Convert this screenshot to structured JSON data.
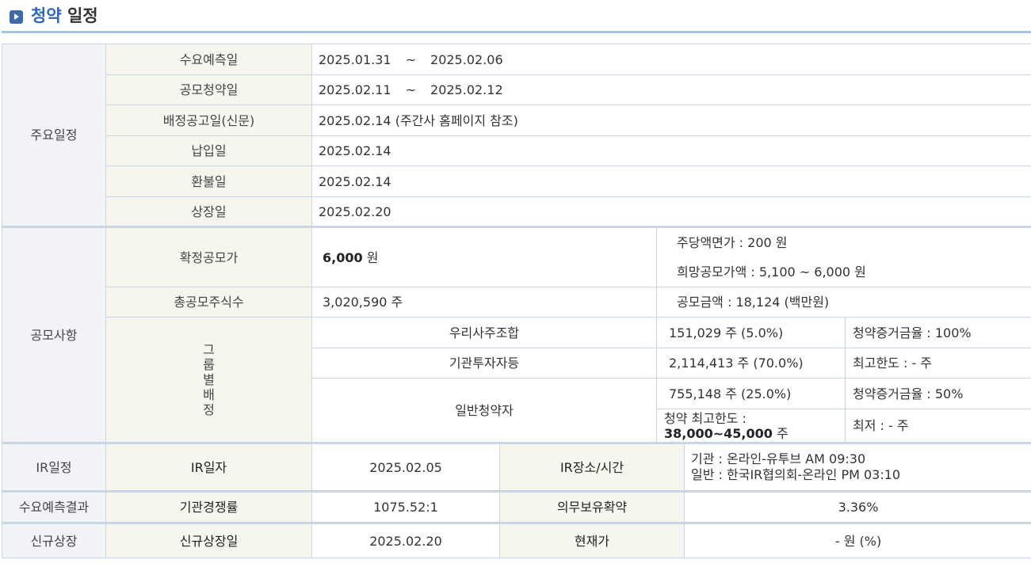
{
  "title": {
    "accent": "청약",
    "rest": " 일정"
  },
  "sections": {
    "key_schedule": {
      "label": "주요일정",
      "rows": [
        {
          "label": "수요예측일",
          "start": "2025.01.31",
          "sep": "~",
          "end": "2025.02.06"
        },
        {
          "label": "공모청약일",
          "start": "2025.02.11",
          "sep": "~",
          "end": "2025.02.12"
        },
        {
          "label": "배정공고일(신문)",
          "value": "2025.02.14 (주간사 홈페이지 참조)"
        },
        {
          "label": "납입일",
          "value": "2025.02.14"
        },
        {
          "label": "환불일",
          "value": "2025.02.14"
        },
        {
          "label": "상장일",
          "value": "2025.02.20"
        }
      ]
    },
    "offering": {
      "label": "공모사항",
      "final_price_label": "확정공모가",
      "final_price": "6,000",
      "final_price_unit": "원",
      "par_value": "주당액면가 :  200 원",
      "desired_price": "희망공모가액 :  5,100 ~ 6,000 원",
      "total_shares_label": "총공모주식수",
      "total_shares": "3,020,590 주",
      "offering_amount": "공모금액 : 18,124 (백만원)",
      "group_label": [
        "그",
        "룹",
        "별",
        "배",
        "정"
      ],
      "groups": {
        "employee": {
          "name": "우리사주조합",
          "shares": "151,029 주  (5.0%)",
          "note": "청약증거금율 : 100%"
        },
        "institution": {
          "name": "기관투자자등",
          "shares": "2,114,413 주  (70.0%)",
          "note": "최고한도 :  - 주"
        },
        "retail": {
          "name": "일반청약자",
          "shares": "755,148 주  (25.0%)",
          "note": "청약증거금율 : 50%",
          "limit_label": "청약 최고한도 :",
          "limit_value": "38,000~45,000",
          "limit_unit": "주",
          "min": "최저 :  - 주"
        }
      }
    },
    "ir": {
      "label": "IR일정",
      "date_label": "IR일자",
      "date": "2025.02.05",
      "place_label": "IR장소/시간",
      "place_line1": "기관 : 온라인-유투브 AM 09:30",
      "place_line2": "일반 : 한국IR협의회-온라인 PM 03:10"
    },
    "demand": {
      "label": "수요예측결과",
      "competition_label": "기관경쟁률",
      "competition": "1075.52:1",
      "lockup_label": "의무보유확약",
      "lockup": "3.36%"
    },
    "listing": {
      "label": "신규상장",
      "date_label": "신규상장일",
      "date": "2025.02.20",
      "price_label": "현재가",
      "price": "- 원 (%)"
    }
  }
}
